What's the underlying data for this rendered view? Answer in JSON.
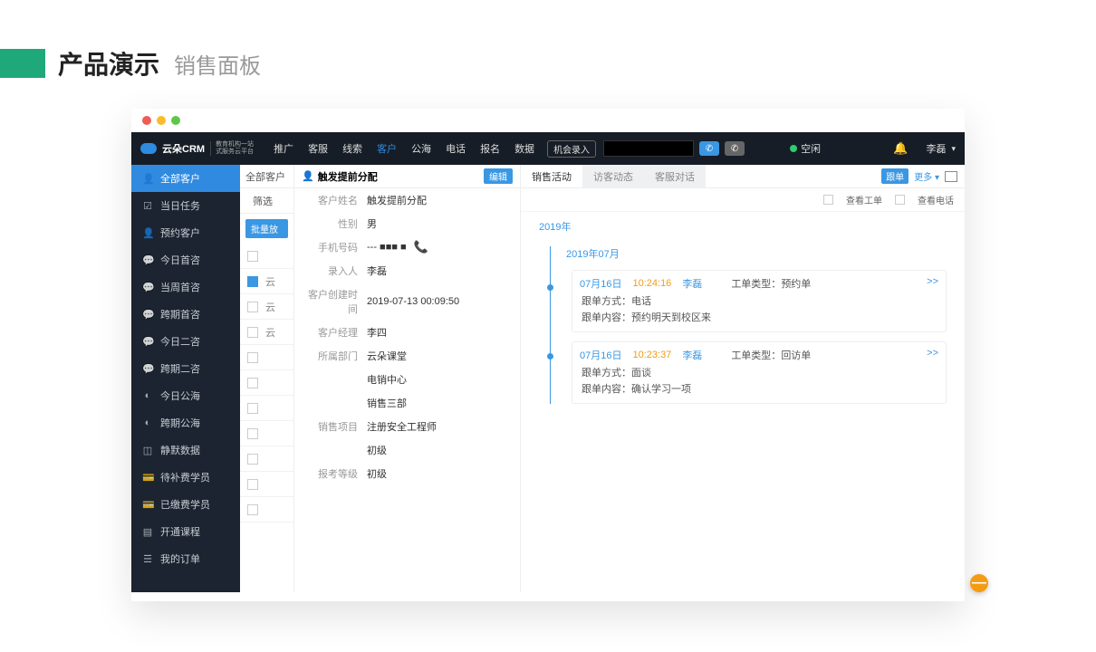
{
  "page": {
    "title": "产品演示",
    "subtitle": "销售面板"
  },
  "topnav": {
    "logo": "云朵CRM",
    "logo_sub1": "教育机构一站",
    "logo_sub2": "式服务云平台",
    "items": [
      "推广",
      "客服",
      "线索",
      "客户",
      "公海",
      "电话",
      "报名",
      "数据"
    ],
    "active_index": 3,
    "opportunity_btn": "机会录入",
    "status": "空闲",
    "user": "李磊"
  },
  "sidebar": {
    "items": [
      {
        "icon": "user",
        "label": "全部客户"
      },
      {
        "icon": "task",
        "label": "当日任务"
      },
      {
        "icon": "cal",
        "label": "预约客户"
      },
      {
        "icon": "msg",
        "label": "今日首咨"
      },
      {
        "icon": "msg",
        "label": "当周首咨"
      },
      {
        "icon": "msg",
        "label": "跨期首咨"
      },
      {
        "icon": "msg",
        "label": "今日二咨"
      },
      {
        "icon": "msg",
        "label": "跨期二咨"
      },
      {
        "icon": "sea",
        "label": "今日公海"
      },
      {
        "icon": "sea",
        "label": "跨期公海"
      },
      {
        "icon": "data",
        "label": "静默数据"
      },
      {
        "icon": "pay",
        "label": "待补费学员"
      },
      {
        "icon": "pay",
        "label": "已缴费学员"
      },
      {
        "icon": "course",
        "label": "开通课程"
      },
      {
        "icon": "order",
        "label": "我的订单"
      }
    ],
    "active_index": 0
  },
  "mid": {
    "title": "全部客户",
    "filter": "筛选",
    "batch_btn": "批量放",
    "rows": [
      "云",
      "云",
      "云",
      "",
      "",
      "",
      "",
      "",
      "",
      ""
    ]
  },
  "detail": {
    "header": "触发提前分配",
    "edit": "编辑",
    "fields": [
      {
        "label": "客户姓名",
        "value": "触发提前分配"
      },
      {
        "label": "性别",
        "value": "男"
      },
      {
        "label": "手机号码",
        "value": "--- ■■■ ■",
        "phone": true
      },
      {
        "label": "录入人",
        "value": "李磊"
      },
      {
        "label": "客户创建时间",
        "value": "2019-07-13 00:09:50"
      },
      {
        "label": "客户经理",
        "value": "李四"
      },
      {
        "label": "所属部门",
        "value": "云朵课堂"
      },
      {
        "label": "",
        "value": "电销中心"
      },
      {
        "label": "",
        "value": "销售三部"
      },
      {
        "label": "销售项目",
        "value": "注册安全工程师"
      },
      {
        "label": "",
        "value": "初级"
      },
      {
        "label": "报考等级",
        "value": "初级"
      }
    ]
  },
  "right": {
    "tabs": [
      "销售活动",
      "访客动态",
      "客服对话"
    ],
    "active_tab": 0,
    "track_btn": "跟单",
    "more": "更多 ▾",
    "filters": [
      {
        "label": "查看工单"
      },
      {
        "label": "查看电话"
      }
    ],
    "year": "2019年",
    "month": "2019年07月",
    "events": [
      {
        "date": "07月16日",
        "time": "10:24:16",
        "user": "李磊",
        "type_label": "工单类型：",
        "type": "预约单",
        "method_label": "跟单方式：",
        "method": "电话",
        "content_label": "跟单内容：",
        "content": "预约明天到校区来",
        "more": ">>"
      },
      {
        "date": "07月16日",
        "time": "10:23:37",
        "user": "李磊",
        "type_label": "工单类型：",
        "type": "回访单",
        "method_label": "跟单方式：",
        "method": "面谈",
        "content_label": "跟单内容：",
        "content": "确认学习一项",
        "more": ">>"
      }
    ]
  },
  "fab": "—"
}
